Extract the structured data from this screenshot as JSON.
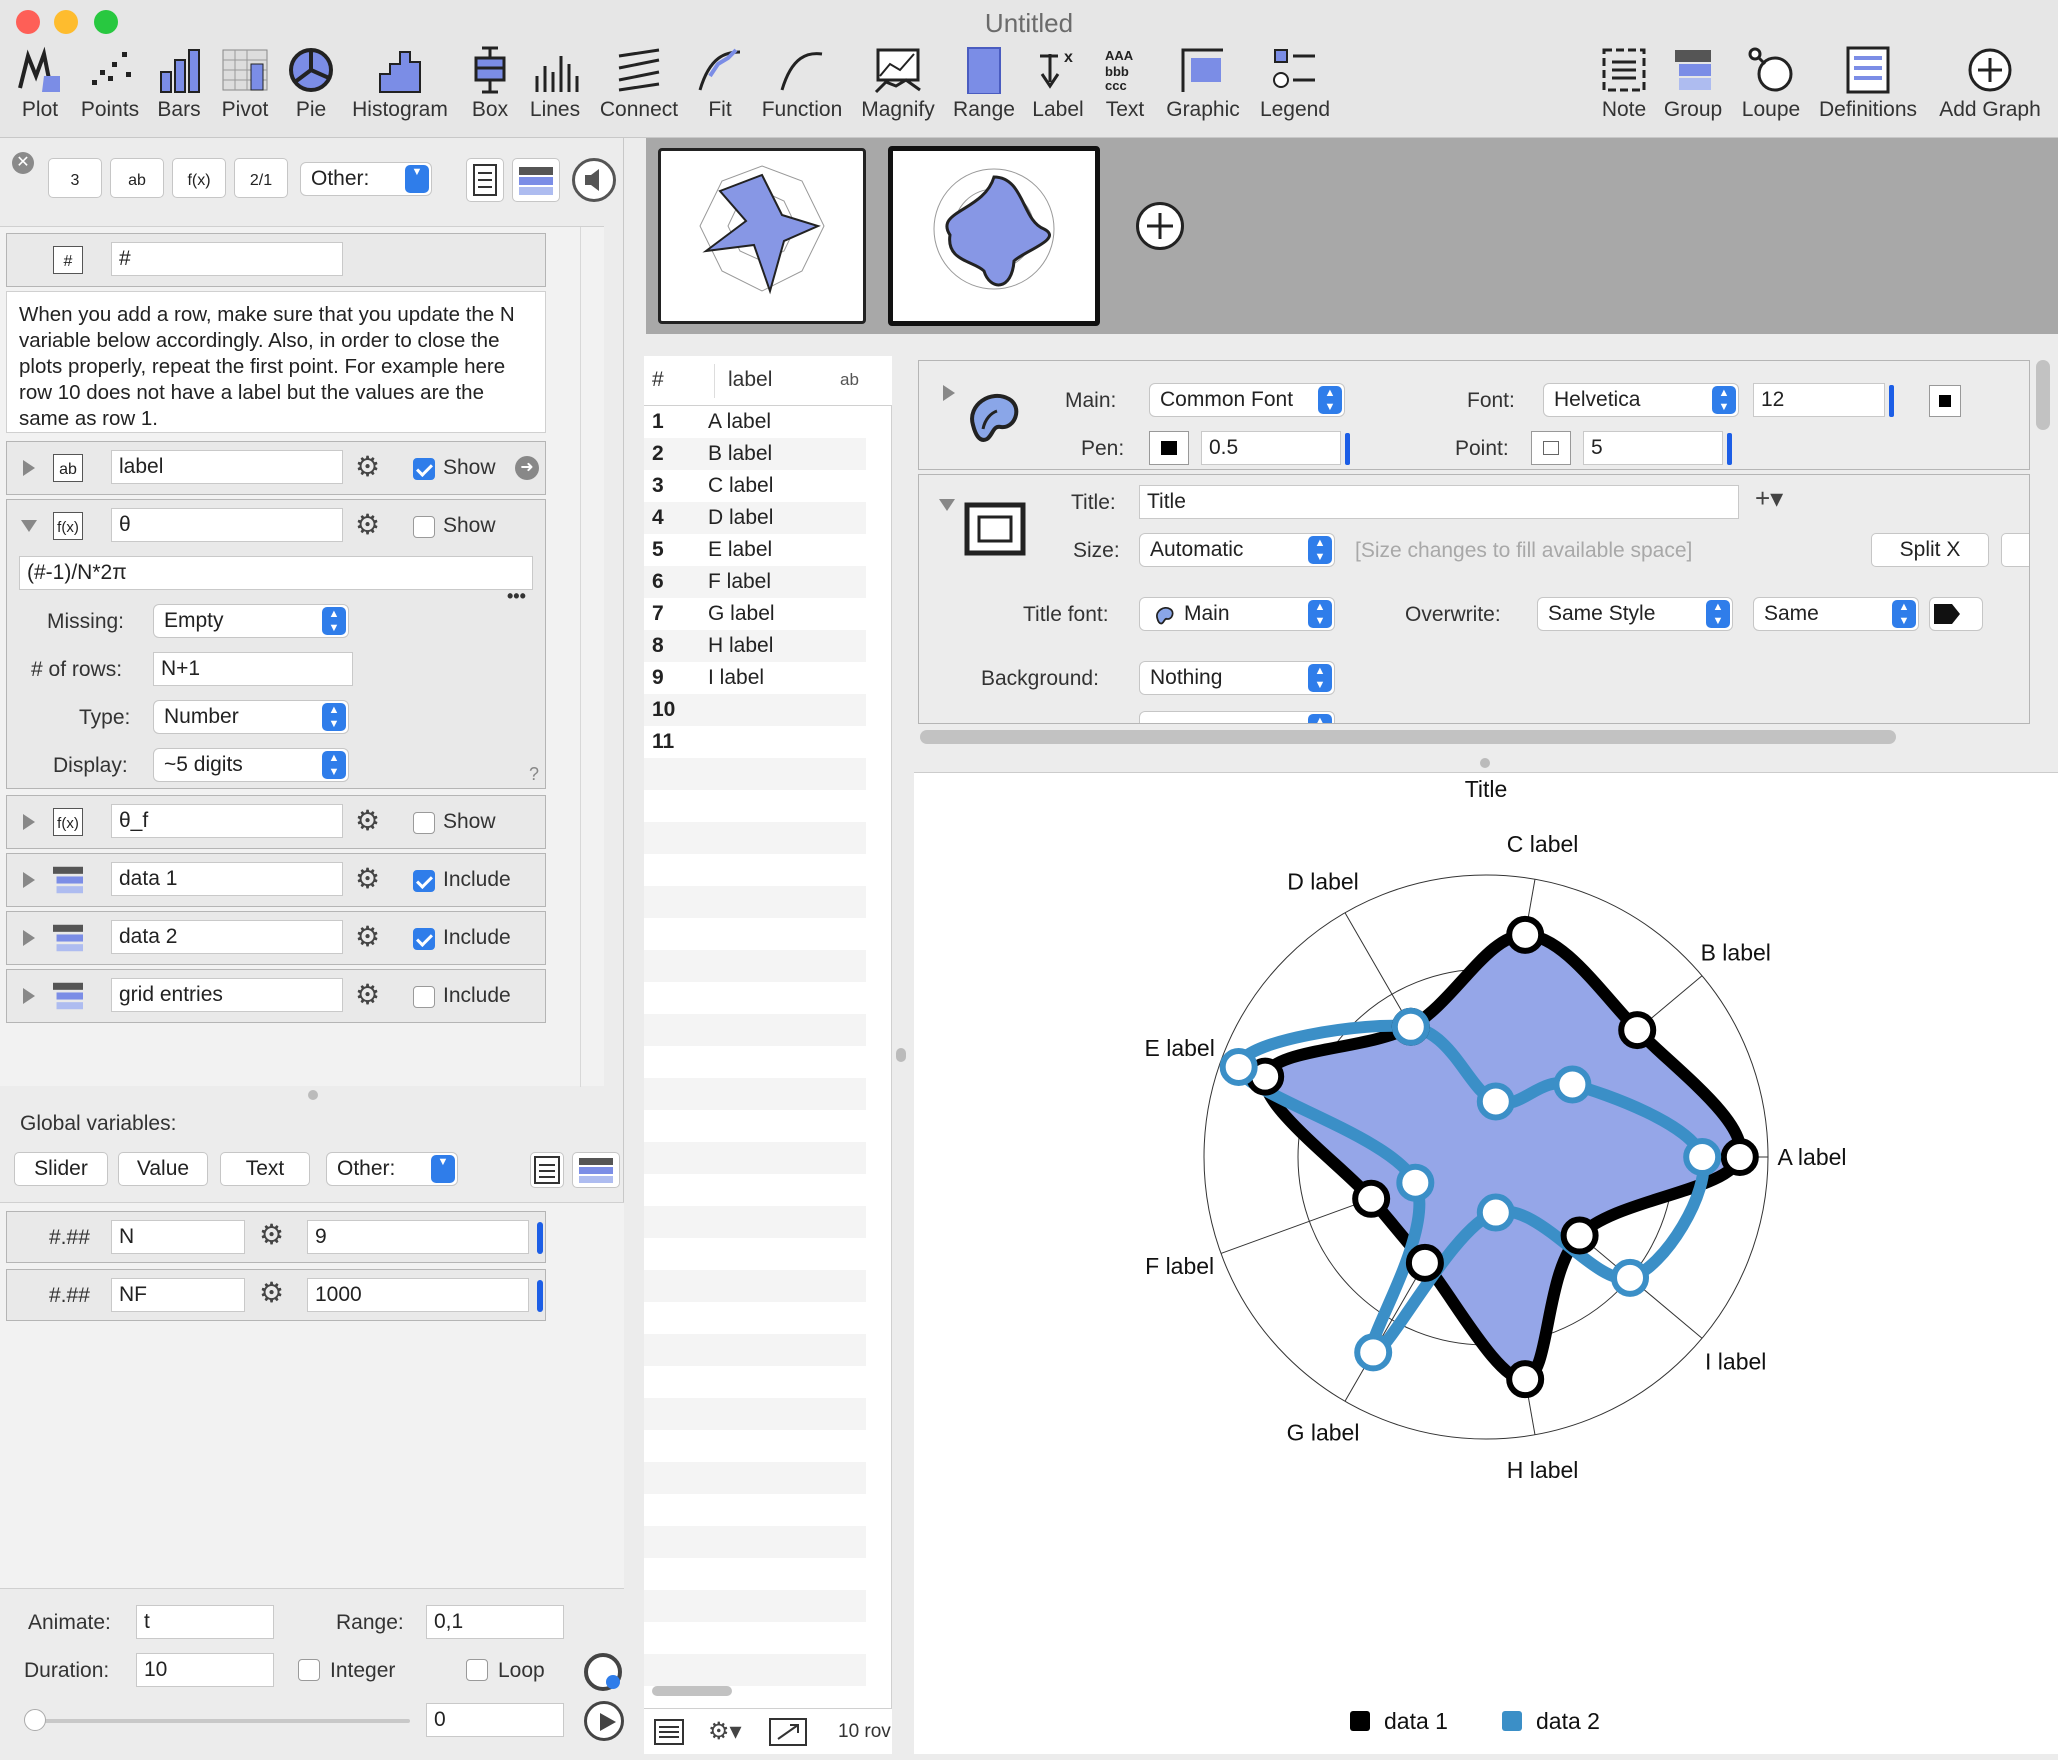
{
  "window": {
    "title": "Untitled"
  },
  "toolbar": {
    "left": [
      "Plot",
      "Points",
      "Bars",
      "Pivot",
      "Pie",
      "Histogram",
      "Box",
      "Lines",
      "Connect",
      "Fit",
      "Function",
      "Magnify",
      "Range",
      "Label",
      "Text",
      "Graphic",
      "Legend"
    ],
    "right": [
      "Note",
      "Group",
      "Loupe",
      "Definitions",
      "Add Graph"
    ]
  },
  "left_panel": {
    "type_buttons": [
      "3",
      "ab",
      "f(x)",
      "2/1"
    ],
    "other_label": "Other:",
    "hash_column": {
      "icon_label": "#",
      "name": "#"
    },
    "note": "When you add a row, make sure that you update the N variable below accordingly. Also, in order to close the plots properly, repeat the first point. For example here row 10 does not have a label but the values are the same as row 1.",
    "label_column": {
      "icon_label": "ab",
      "name": "label",
      "option": "Show",
      "checked": true
    },
    "theta_column": {
      "icon_label": "f(x)",
      "name": "θ",
      "option": "Show",
      "checked": false,
      "formula": "(#-1)/N*2π",
      "more": "•••",
      "missing_label": "Missing:",
      "missing_value": "Empty",
      "rows_label": "# of rows:",
      "rows_value": "N+1",
      "type_label": "Type:",
      "type_value": "Number",
      "display_label": "Display:",
      "display_value": "~5 digits",
      "help": "?"
    },
    "theta_f_column": {
      "icon_label": "f(x)",
      "name": "θ_f",
      "option": "Show",
      "checked": false
    },
    "data_columns": [
      {
        "name": "data 1",
        "option": "Include",
        "checked": true
      },
      {
        "name": "data 2",
        "option": "Include",
        "checked": true
      },
      {
        "name": "grid entries",
        "option": "Include",
        "checked": false
      }
    ],
    "global": {
      "title": "Global variables:",
      "buttons": [
        "Slider",
        "Value",
        "Text"
      ],
      "other_label": "Other:",
      "vars": [
        {
          "format": "#.##",
          "name": "N",
          "value": "9"
        },
        {
          "format": "#.##",
          "name": "NF",
          "value": "1000"
        }
      ]
    },
    "animate": {
      "animate_label": "Animate:",
      "animate_value": "t",
      "range_label": "Range:",
      "range_value": "0,1",
      "duration_label": "Duration:",
      "duration_value": "10",
      "integer_label": "Integer",
      "loop_label": "Loop",
      "slider_value": "0"
    }
  },
  "table": {
    "headers": {
      "num": "#",
      "label": "label",
      "type": "ab"
    },
    "rows": [
      {
        "n": "1",
        "label": "A label"
      },
      {
        "n": "2",
        "label": "B label"
      },
      {
        "n": "3",
        "label": "C label"
      },
      {
        "n": "4",
        "label": "D label"
      },
      {
        "n": "5",
        "label": "E label"
      },
      {
        "n": "6",
        "label": "F label"
      },
      {
        "n": "7",
        "label": "G label"
      },
      {
        "n": "8",
        "label": "H label"
      },
      {
        "n": "9",
        "label": "I label"
      },
      {
        "n": "10",
        "label": ""
      },
      {
        "n": "11",
        "label": ""
      }
    ],
    "footer": "10 rov"
  },
  "settings": {
    "main_label": "Main:",
    "main_value": "Common Font",
    "font_label": "Font:",
    "font_value": "Helvetica",
    "font_size": "12",
    "pen_label": "Pen:",
    "pen_value": "0.5",
    "point_label": "Point:",
    "point_value": "5",
    "title_label": "Title:",
    "title_value": "Title",
    "size_label": "Size:",
    "size_value": "Automatic",
    "size_hint": "[Size changes to fill available space]",
    "split_label": "Split X",
    "title_font_label": "Title font:",
    "title_font_value": "Main",
    "overwrite_label": "Overwrite:",
    "overwrite_value": "Same Style",
    "overwrite_value2": "Same",
    "background_label": "Background:",
    "background_value": "Nothing"
  },
  "graph": {
    "title": "Title",
    "legend": [
      {
        "name": "data 1",
        "color": "#000000"
      },
      {
        "name": "data 2",
        "color": "#3b8fc7"
      }
    ]
  },
  "chart_data": {
    "type": "radar",
    "title": "Title",
    "categories": [
      "A label",
      "B label",
      "C label",
      "D label",
      "E label",
      "F label",
      "G label",
      "H label",
      "I label"
    ],
    "rlim": [
      0,
      3
    ],
    "grid": true,
    "legend_position": "bottom",
    "fill_color": "#95a6e8",
    "series": [
      {
        "name": "data 1",
        "color": "#000000",
        "values": [
          2.7,
          2.1,
          2.4,
          1.6,
          2.5,
          1.3,
          1.3,
          2.4,
          1.3
        ]
      },
      {
        "name": "data 2",
        "color": "#3b8fc7",
        "values": [
          2.3,
          1.2,
          0.6,
          1.6,
          2.8,
          0.8,
          2.4,
          0.6,
          2.0
        ]
      }
    ]
  }
}
